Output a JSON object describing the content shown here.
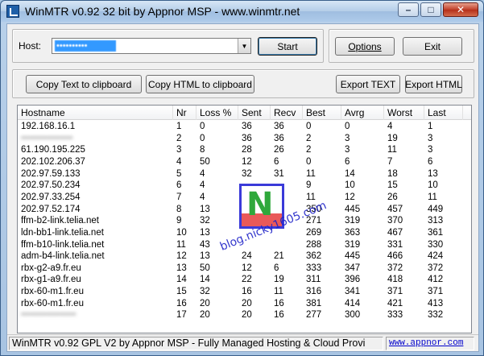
{
  "window": {
    "title": "WinMTR v0.92 32 bit by Appnor MSP - www.winmtr.net",
    "minimize_label": "–",
    "maximize_label": "□",
    "close_label": "✕"
  },
  "host": {
    "label": "Host:",
    "value": "••••••••••",
    "start_label": "Start"
  },
  "buttons": {
    "options": "Options",
    "exit": "Exit",
    "copy_text": "Copy Text to clipboard",
    "copy_html": "Copy HTML to clipboard",
    "export_text": "Export TEXT",
    "export_html": "Export HTML"
  },
  "table": {
    "columns": [
      "Hostname",
      "Nr",
      "Loss %",
      "Sent",
      "Recv",
      "Best",
      "Avrg",
      "Worst",
      "Last"
    ],
    "rows": [
      {
        "hostname": "192.168.16.1",
        "nr": "1",
        "loss": "0",
        "sent": "36",
        "recv": "36",
        "best": "0",
        "avrg": "0",
        "worst": "4",
        "last": "1"
      },
      {
        "hostname": "••••••••••••••••",
        "nr": "2",
        "loss": "0",
        "sent": "36",
        "recv": "36",
        "best": "2",
        "avrg": "3",
        "worst": "19",
        "last": "3",
        "redacted": true
      },
      {
        "hostname": "61.190.195.225",
        "nr": "3",
        "loss": "8",
        "sent": "28",
        "recv": "26",
        "best": "2",
        "avrg": "3",
        "worst": "11",
        "last": "3"
      },
      {
        "hostname": "202.102.206.37",
        "nr": "4",
        "loss": "50",
        "sent": "12",
        "recv": "6",
        "best": "0",
        "avrg": "6",
        "worst": "7",
        "last": "6"
      },
      {
        "hostname": "202.97.59.133",
        "nr": "5",
        "loss": "4",
        "sent": "32",
        "recv": "31",
        "best": "11",
        "avrg": "14",
        "worst": "18",
        "last": "13"
      },
      {
        "hostname": "202.97.50.234",
        "nr": "6",
        "loss": "4",
        "sent": "",
        "recv": "",
        "best": "9",
        "avrg": "10",
        "worst": "15",
        "last": "10"
      },
      {
        "hostname": "202.97.33.254",
        "nr": "7",
        "loss": "4",
        "sent": "",
        "recv": "",
        "best": "11",
        "avrg": "12",
        "worst": "26",
        "last": "11"
      },
      {
        "hostname": "202.97.52.174",
        "nr": "8",
        "loss": "13",
        "sent": "",
        "recv": "",
        "best": "350",
        "avrg": "445",
        "worst": "457",
        "last": "449"
      },
      {
        "hostname": "ffm-b2-link.telia.net",
        "nr": "9",
        "loss": "32",
        "sent": "",
        "recv": "",
        "best": "271",
        "avrg": "319",
        "worst": "370",
        "last": "313"
      },
      {
        "hostname": "ldn-bb1-link.telia.net",
        "nr": "10",
        "loss": "13",
        "sent": "",
        "recv": "",
        "best": "269",
        "avrg": "363",
        "worst": "467",
        "last": "361"
      },
      {
        "hostname": "ffm-b10-link.telia.net",
        "nr": "11",
        "loss": "43",
        "sent": "",
        "recv": "",
        "best": "288",
        "avrg": "319",
        "worst": "331",
        "last": "330"
      },
      {
        "hostname": "adm-b4-link.telia.net",
        "nr": "12",
        "loss": "13",
        "sent": "24",
        "recv": "21",
        "best": "362",
        "avrg": "445",
        "worst": "466",
        "last": "424"
      },
      {
        "hostname": "rbx-g2-a9.fr.eu",
        "nr": "13",
        "loss": "50",
        "sent": "12",
        "recv": "6",
        "best": "333",
        "avrg": "347",
        "worst": "372",
        "last": "372"
      },
      {
        "hostname": "rbx-g1-a9.fr.eu",
        "nr": "14",
        "loss": "14",
        "sent": "22",
        "recv": "19",
        "best": "311",
        "avrg": "396",
        "worst": "418",
        "last": "412"
      },
      {
        "hostname": "rbx-60-m1.fr.eu",
        "nr": "15",
        "loss": "32",
        "sent": "16",
        "recv": "11",
        "best": "316",
        "avrg": "341",
        "worst": "371",
        "last": "371"
      },
      {
        "hostname": "rbx-60-m1.fr.eu",
        "nr": "16",
        "loss": "20",
        "sent": "20",
        "recv": "16",
        "best": "381",
        "avrg": "414",
        "worst": "421",
        "last": "413"
      },
      {
        "hostname": "•••••••••••••••••",
        "nr": "17",
        "loss": "20",
        "sent": "20",
        "recv": "16",
        "best": "277",
        "avrg": "300",
        "worst": "333",
        "last": "332",
        "redacted": true
      }
    ]
  },
  "watermark": {
    "logo_letter": "N",
    "text": "blog.nicky1605.com"
  },
  "status": {
    "text": "WinMTR v0.92 GPL V2 by Appnor MSP - Fully Managed Hosting & Cloud Provi",
    "link": "www.appnor.com"
  }
}
